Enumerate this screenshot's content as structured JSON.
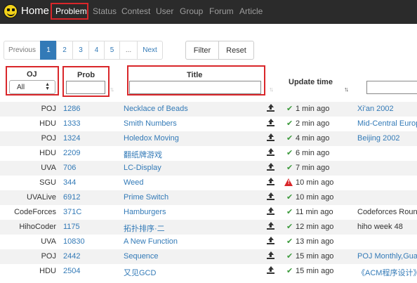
{
  "navbar": {
    "brand": "Home",
    "items": [
      {
        "label": "Problem",
        "active": true
      },
      {
        "label": "Status"
      },
      {
        "label": "Contest"
      },
      {
        "label": "User"
      },
      {
        "label": "Group"
      },
      {
        "label": "Forum"
      },
      {
        "label": "Article"
      }
    ]
  },
  "pagination": {
    "previous": "Previous",
    "pages": [
      "1",
      "2",
      "3",
      "4",
      "5",
      "..."
    ],
    "current": "1",
    "next": "Next"
  },
  "buttons": {
    "filter": "Filter",
    "reset": "Reset"
  },
  "table": {
    "headers": {
      "oj": "OJ",
      "prob": "Prob",
      "title": "Title",
      "update_time": "Update time"
    },
    "oj_filter_value": "All",
    "rows": [
      {
        "oj": "POJ",
        "prob": "1286",
        "title": "Necklace of Beads",
        "status": "ok",
        "time": "1 min ago",
        "source": "Xi'an 2002",
        "source_link": true
      },
      {
        "oj": "HDU",
        "prob": "1333",
        "title": "Smith Numbers",
        "status": "ok",
        "time": "2 min ago",
        "source": "Mid-Central Europ",
        "source_link": true
      },
      {
        "oj": "POJ",
        "prob": "1324",
        "title": "Holedox Moving",
        "status": "ok",
        "time": "4 min ago",
        "source": "Beijing 2002",
        "source_link": true
      },
      {
        "oj": "HDU",
        "prob": "2209",
        "title": "翻纸牌游戏",
        "status": "ok",
        "time": "6 min ago",
        "source": "",
        "source_link": false
      },
      {
        "oj": "UVA",
        "prob": "706",
        "title": "LC-Display",
        "status": "ok",
        "time": "7 min ago",
        "source": "",
        "source_link": false
      },
      {
        "oj": "SGU",
        "prob": "344",
        "title": "Weed",
        "status": "warn",
        "time": "10 min ago",
        "source": "",
        "source_link": false
      },
      {
        "oj": "UVALive",
        "prob": "6912",
        "title": "Prime Switch",
        "status": "ok",
        "time": "10 min ago",
        "source": "",
        "source_link": false
      },
      {
        "oj": "CodeForces",
        "prob": "371C",
        "title": "Hamburgers",
        "status": "ok",
        "time": "11 min ago",
        "source": "Codeforces Round",
        "source_link": false
      },
      {
        "oj": "HihoCoder",
        "prob": "1175",
        "title": "拓扑排序·二",
        "status": "ok",
        "time": "12 min ago",
        "source": "hiho week 48",
        "source_link": false
      },
      {
        "oj": "UVA",
        "prob": "10830",
        "title": "A New Function",
        "status": "ok",
        "time": "13 min ago",
        "source": "",
        "source_link": false
      },
      {
        "oj": "POJ",
        "prob": "2442",
        "title": "Sequence",
        "status": "ok",
        "time": "15 min ago",
        "source": "POJ Monthly,Gua",
        "source_link": true
      },
      {
        "oj": "HDU",
        "prob": "2504",
        "title": "又见GCD",
        "status": "ok",
        "time": "15 min ago",
        "source": "《ACM程序设计》短",
        "source_link": true
      }
    ]
  },
  "colors": {
    "highlight": "#d9262a",
    "link": "#337ab7",
    "navbar": "#2b2b2b",
    "ok": "#3c9a3c"
  },
  "icons": {
    "upload": "upload-icon",
    "ok": "check-icon",
    "warn": "warning-icon"
  }
}
